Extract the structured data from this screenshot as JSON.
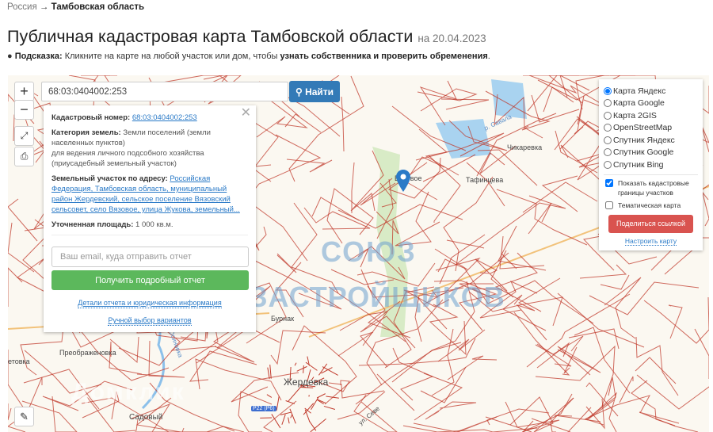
{
  "breadcrumb": {
    "root": "Россия",
    "arrow": "→",
    "current": "Тамбовская область"
  },
  "title": "Публичная кадастровая карта Тамбовской области",
  "date": "на 20.04.2023",
  "hint": {
    "label": "Подсказка:",
    "text": "Кликните на карте на любой участок или дом, чтобы",
    "bold": "узнать собственника и проверить обременения",
    "end": "."
  },
  "map": {
    "zoom_in": "+",
    "zoom_out": "−",
    "search_value": "68:03:0404002:253",
    "find_label": "Найти",
    "labels": [
      "Вязовое",
      "Тафинцева",
      "Чикаревка",
      "р. Савала",
      "Бурнак",
      "Преображеновка",
      "Жердевка",
      "Садовый",
      "ул. Севе",
      "р. Осиновка",
      "етовка",
      "Р22 (Р6)"
    ],
    "watermark": [
      "СОЮЗ",
      "ЗАСТРОЙЩИКОВ",
      "Домклик"
    ],
    "colors": {
      "parcel": "#c0392b",
      "accent": "#337ab7",
      "green": "#5cb85c",
      "red": "#d9534f"
    }
  },
  "popup": {
    "cad_label": "Кадастровый номер:",
    "cad_value": "68:03:0404002:253",
    "cat_label": "Категория земель:",
    "cat_value": "Земли поселений (земли населенных пунктов)",
    "use": "для ведения личного подсобного хозяйства (приусадебный земельный участок)",
    "addr_label": "Земельный участок по адресу:",
    "addr_value": "Российская Федерация, Тамбовская область, муниципальный район Жердевский, сельское поселение Вязовский сельсовет, село Вязовое, улица Жукова, земельный...",
    "area_label": "Уточненная площадь:",
    "area_value": "1 000 кв.м.",
    "email_placeholder": "Ваш email, куда отправить отчет",
    "report_button": "Получить подробный отчет",
    "details_link": "Детали отчета и юридическая информация",
    "manual_link": "Ручной выбор вариантов"
  },
  "layers": {
    "options": [
      "Карта Яндекс",
      "Карта Google",
      "Карта 2GIS",
      "OpenStreetMap",
      "Спутник Яндекс",
      "Спутник Google",
      "Спутник Bing"
    ],
    "selected": "Карта Яндекс",
    "show_borders": "Показать кадастровые границы участков",
    "show_borders_checked": true,
    "thematic": "Тематическая карта",
    "thematic_checked": false,
    "share": "Поделиться ссылкой",
    "configure": "Настроить карту"
  }
}
